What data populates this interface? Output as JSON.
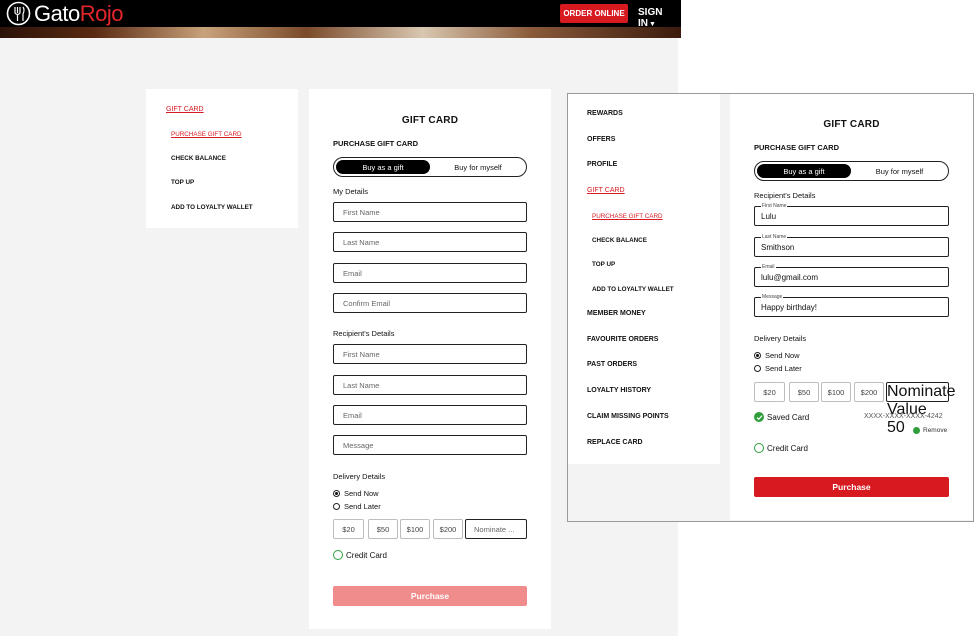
{
  "header": {
    "logo_left": "Gato",
    "logo_right": "Rojo",
    "order_online": "ORDER ONLINE",
    "sign_in": "SIGN IN"
  },
  "colors": {
    "brand_red": "#d71920",
    "purchase_disabled": "#f08c8c",
    "success_green": "#2e9e3a"
  },
  "left_menu": {
    "items": [
      "GIFT CARD",
      "PURCHASE GIFT CARD",
      "CHECK BALANCE",
      "TOP UP",
      "ADD TO LOYALTY WALLET"
    ]
  },
  "right_menu": {
    "items": [
      "REWARDS",
      "OFFERS",
      "PROFILE",
      "GIFT CARD",
      "PURCHASE GIFT CARD",
      "CHECK BALANCE",
      "TOP UP",
      "ADD TO LOYALTY WALLET",
      "MEMBER MONEY",
      "FAVOURITE ORDERS",
      "PAST ORDERS",
      "LOYALTY HISTORY",
      "CLAIM MISSING POINTS",
      "REPLACE CARD"
    ]
  },
  "left_card": {
    "title": "GIFT CARD",
    "subtitle": "PURCHASE GIFT CARD",
    "toggle": {
      "gift": "Buy as a gift",
      "myself": "Buy for myself"
    },
    "my_details": {
      "label": "My Details",
      "first_name": "First Name",
      "last_name": "Last Name",
      "email": "Email",
      "confirm_email": "Confirm Email"
    },
    "recipient": {
      "label": "Recipient's Details",
      "first_name": "First Name",
      "last_name": "Last Name",
      "email": "Email",
      "message": "Message"
    },
    "delivery": {
      "label": "Delivery Details",
      "send_now": "Send Now",
      "send_later": "Send Later"
    },
    "amounts": [
      "$20",
      "$50",
      "$100",
      "$200"
    ],
    "nominate_placeholder": "Nominate ...",
    "credit_card": "Credit Card",
    "purchase": "Purchase"
  },
  "right_card": {
    "title": "GIFT CARD",
    "subtitle": "PURCHASE GIFT CARD",
    "toggle": {
      "gift": "Buy as a gift",
      "myself": "Buy for myself"
    },
    "recipient": {
      "label": "Recipient's Details",
      "first_name_label": "First Name",
      "first_name_value": "Lulu",
      "last_name_label": "Last Name",
      "last_name_value": "Smithson",
      "email_label": "Email",
      "email_value": "lulu@gmail.com",
      "message_label": "Message",
      "message_value": "Happy birthday!"
    },
    "delivery": {
      "label": "Delivery Details",
      "send_now": "Send Now",
      "send_later": "Send Later"
    },
    "amounts": [
      "$20",
      "$50",
      "$100",
      "$200"
    ],
    "nominate_label": "Nominate Value",
    "nominate_value": "50",
    "saved_card": "Saved Card",
    "card_number": "XXXX-XXXX-XXXX-4242",
    "remove": "Remove",
    "credit_card": "Credit Card",
    "purchase": "Purchase"
  }
}
